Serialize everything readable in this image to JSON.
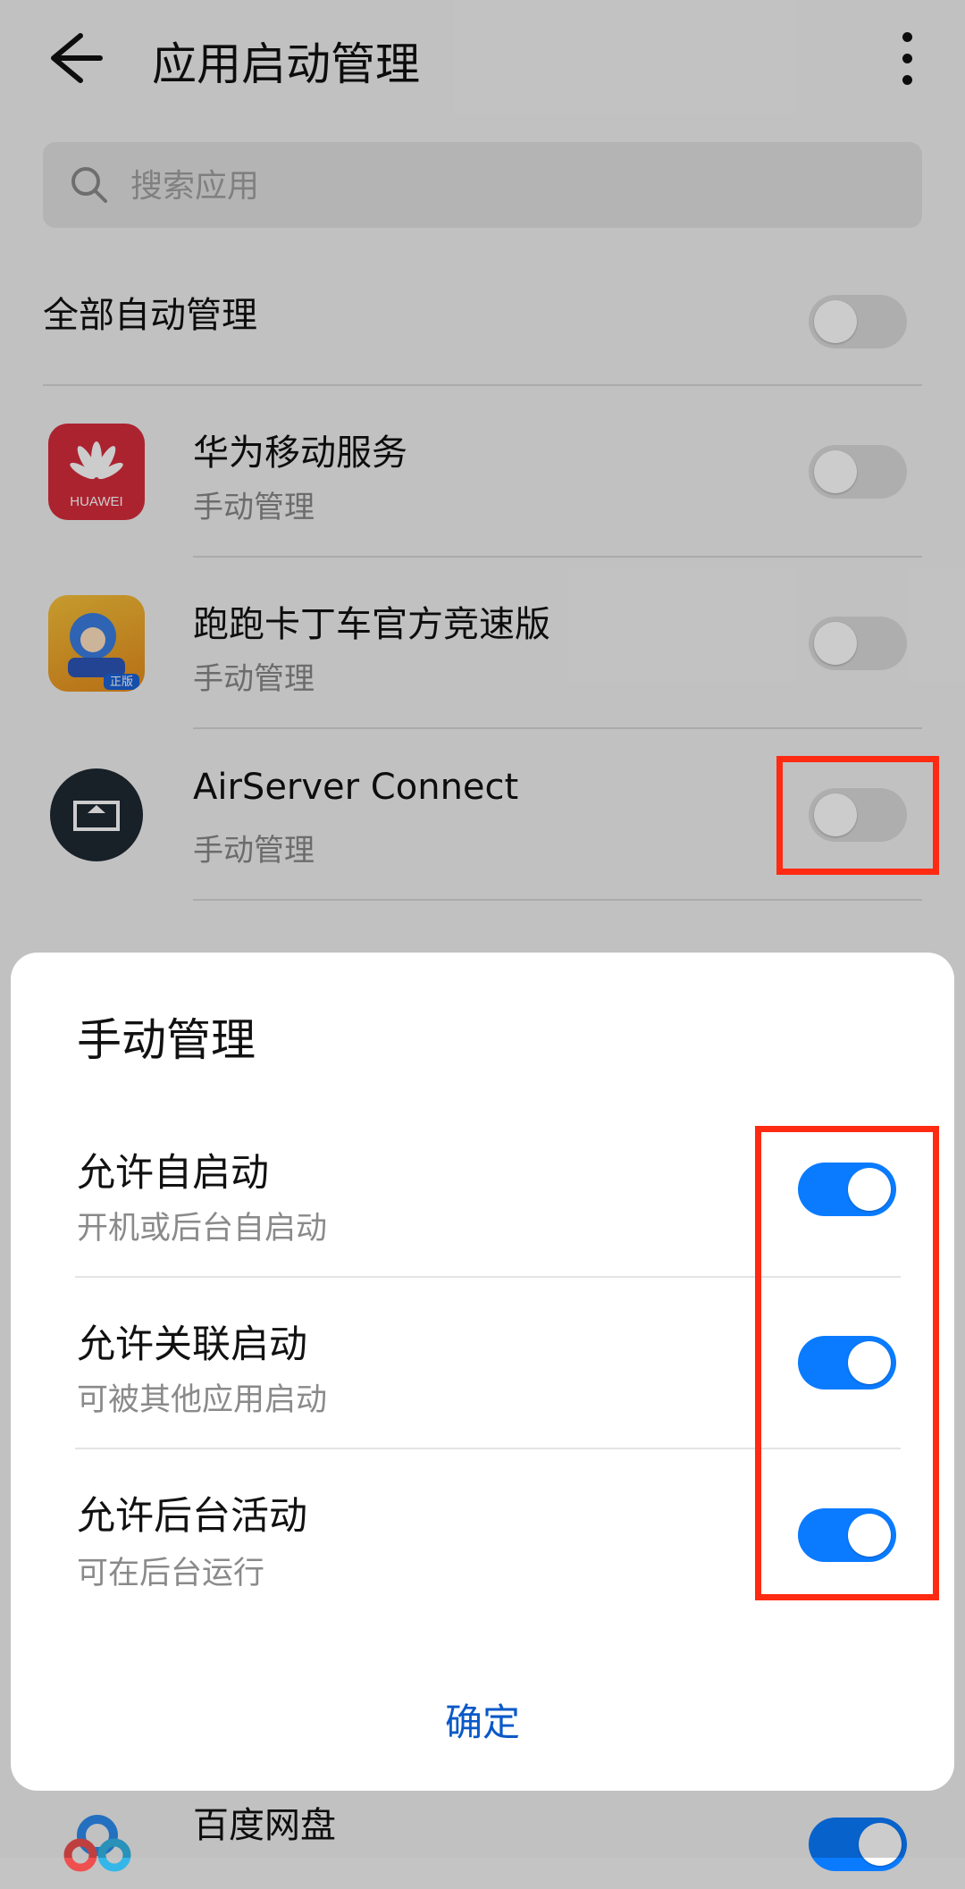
{
  "header": {
    "title": "应用启动管理"
  },
  "search": {
    "placeholder": "搜索应用"
  },
  "all_auto": {
    "label": "全部自动管理",
    "enabled": false
  },
  "apps": [
    {
      "name": "华为移动服务",
      "status": "手动管理",
      "icon": "huawei-icon",
      "icon_text": "HUAWEI",
      "enabled": false
    },
    {
      "name": "跑跑卡丁车官方竞速版",
      "status": "手动管理",
      "icon": "kart-game-icon",
      "icon_text": "正版",
      "enabled": false
    },
    {
      "name": "AirServer Connect",
      "status": "手动管理",
      "icon": "airserver-icon",
      "enabled": false
    },
    {
      "name": "百度网盘",
      "status": "",
      "icon": "baidu-netdisk-icon",
      "enabled": true
    }
  ],
  "dialog": {
    "title": "手动管理",
    "options": [
      {
        "label": "允许自启动",
        "description": "开机或后台自启动",
        "enabled": true
      },
      {
        "label": "允许关联启动",
        "description": "可被其他应用启动",
        "enabled": true
      },
      {
        "label": "允许后台活动",
        "description": "可在后台运行",
        "enabled": true
      }
    ],
    "confirm_label": "确定"
  },
  "colors": {
    "accent": "#0a7bff",
    "highlight": "#ff2a12",
    "confirm": "#0a59c7",
    "huawei_red": "#d72c3c"
  }
}
